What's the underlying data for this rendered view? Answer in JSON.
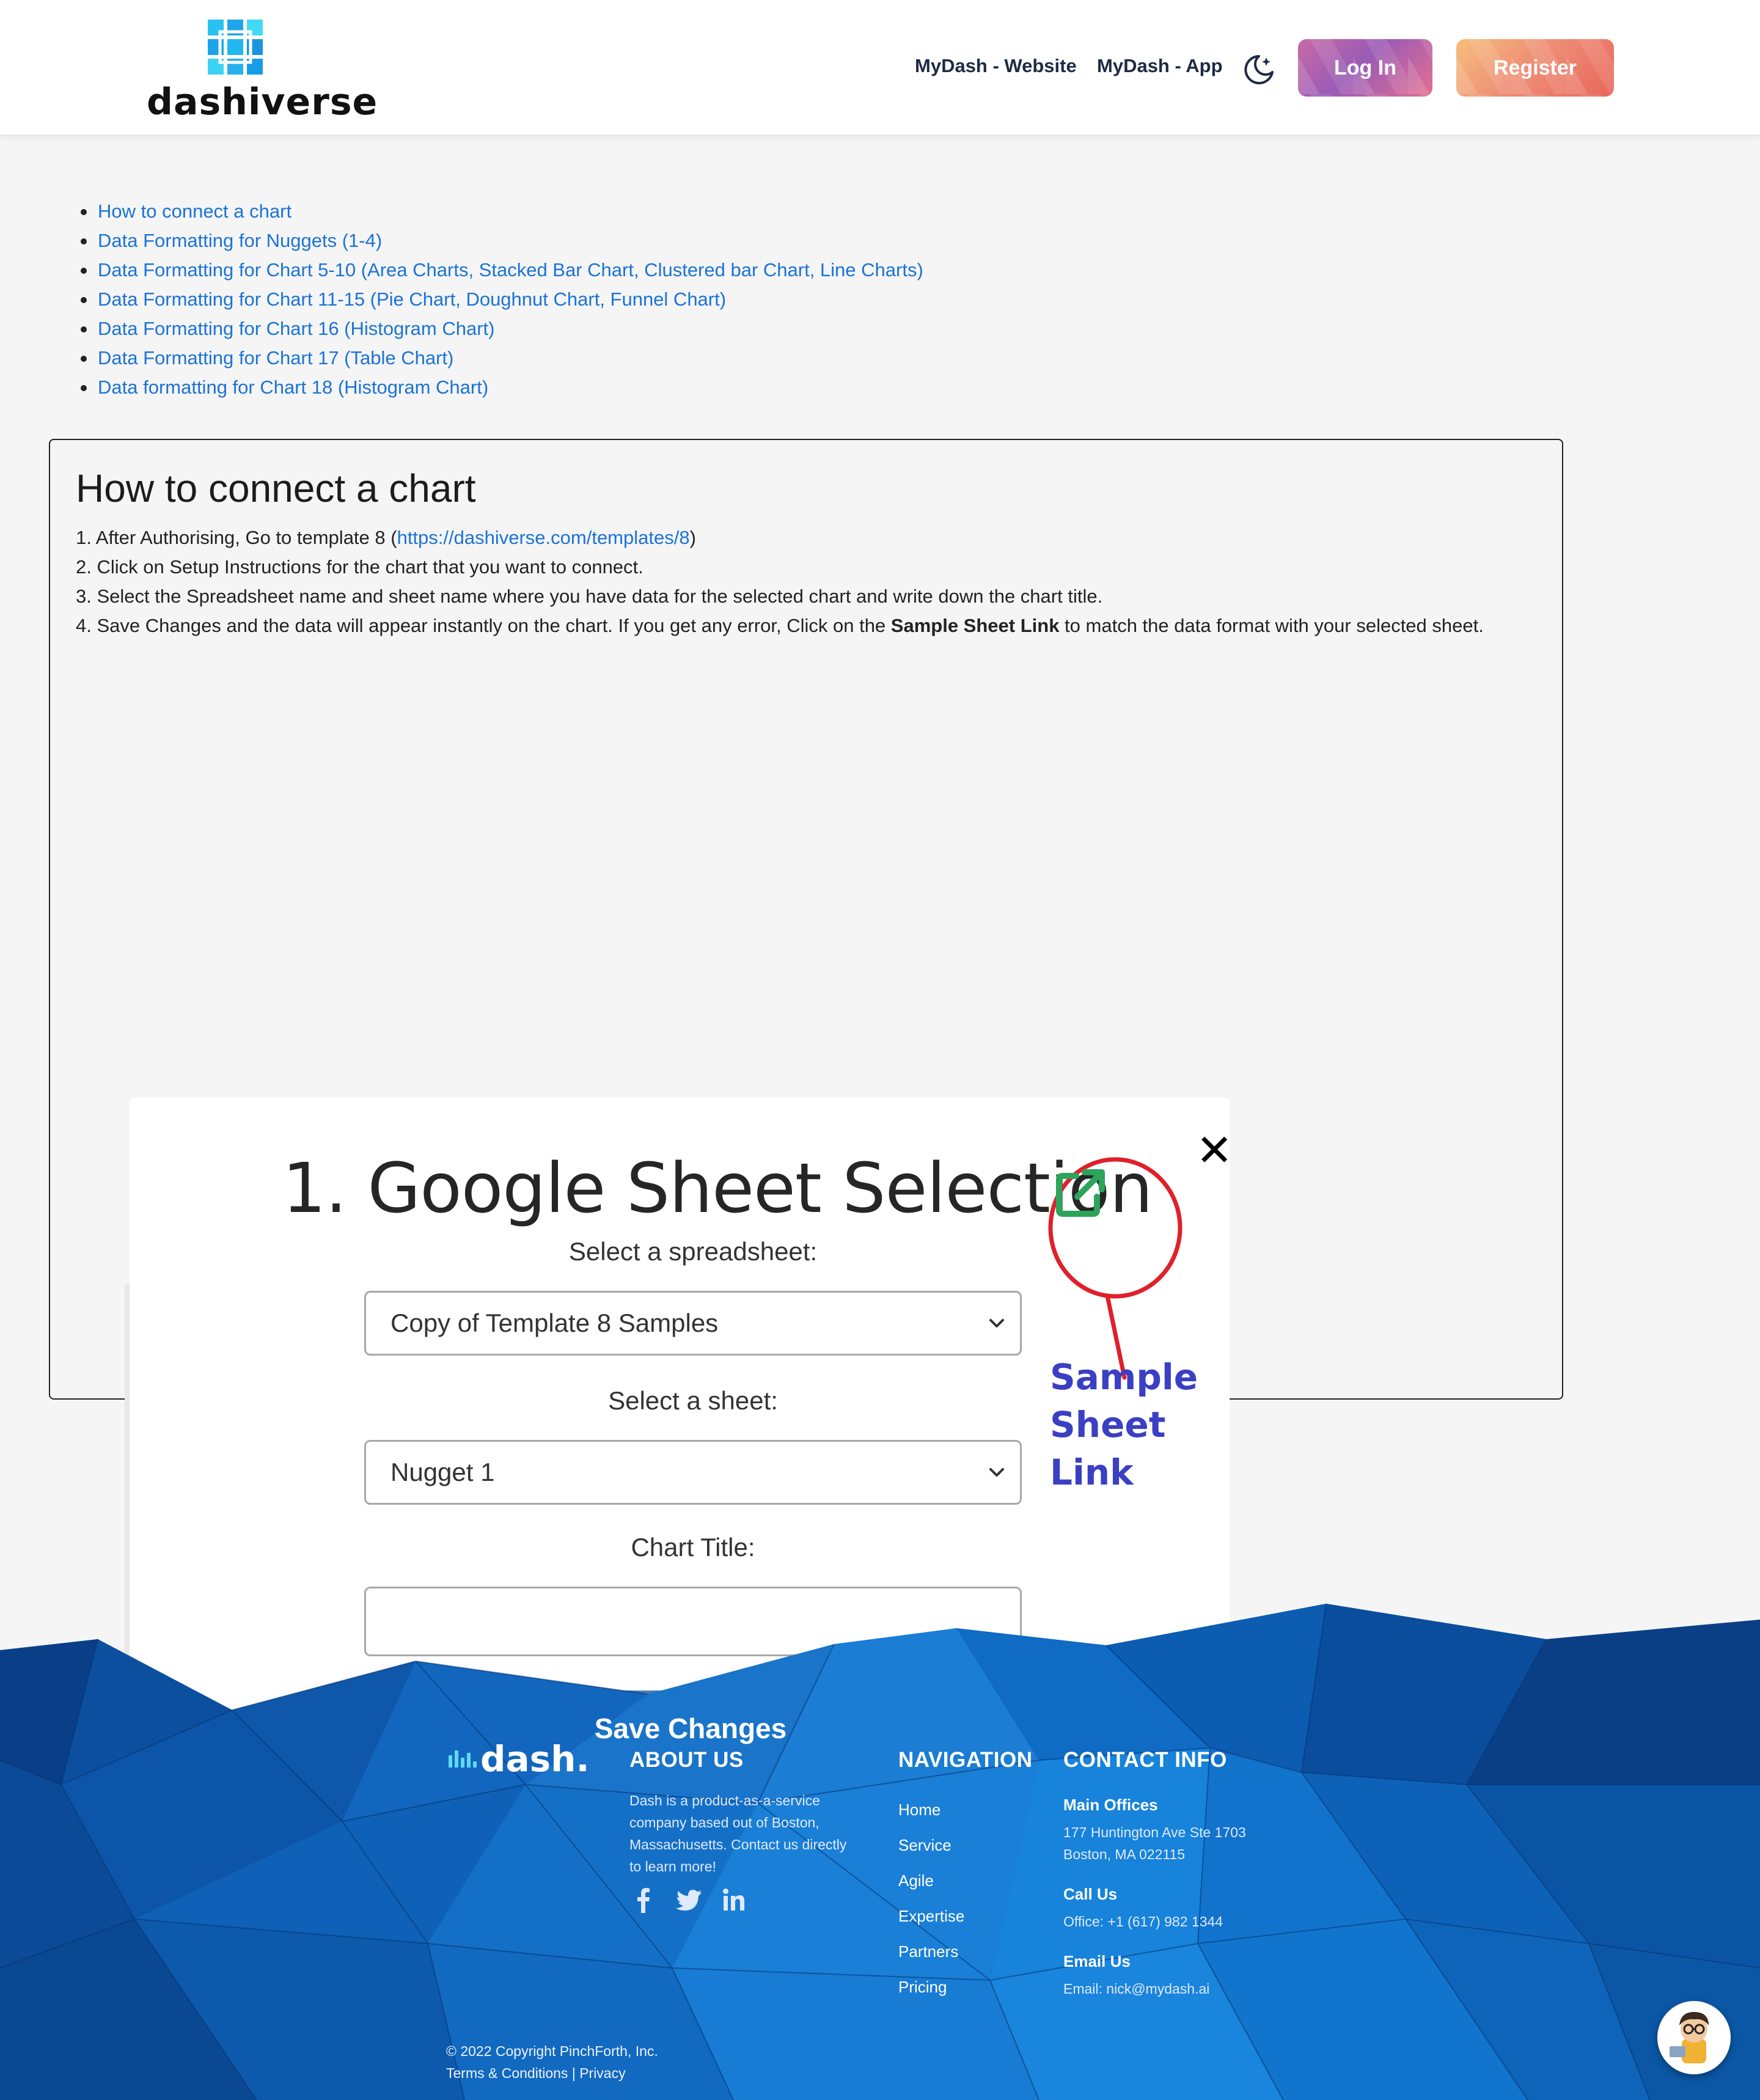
{
  "header": {
    "logo_text": "dashiverse",
    "nav": [
      "MyDash - Website",
      "MyDash - App"
    ],
    "login_label": "Log In",
    "register_label": "Register"
  },
  "toc": [
    "How to connect a chart",
    "Data Formatting for Nuggets (1-4)",
    "Data Formatting for Chart 5-10 (Area Charts, Stacked Bar Chart, Clustered bar Chart, Line Charts)",
    "Data Formatting for Chart 11-15 (Pie Chart, Doughnut Chart, Funnel Chart)",
    "Data Formatting for Chart 16 (Histogram Chart)",
    "Data Formatting for Chart 17 (Table Chart)",
    "Data formatting for Chart 18 (Histogram Chart)"
  ],
  "section": {
    "title": "How to connect a chart",
    "step1_prefix": "After Authorising, Go to template 8 (",
    "step1_link": "https://dashiverse.com/templates/8",
    "step1_suffix": ")",
    "step2": "Click on Setup Instructions for the chart that you want to connect.",
    "step3": "Select the Spreadsheet name and sheet name where you have data for the selected chart and write down the chart title.",
    "step4_prefix": "Save Changes and the data will appear instantly on the chart. If you get any error, Click on the ",
    "step4_bold": "Sample Sheet Link",
    "step4_suffix": " to match the data format with your selected sheet."
  },
  "screenshot": {
    "title": "1. Google Sheet Selection",
    "close": "✕",
    "spreadsheet_label": "Select a spreadsheet:",
    "spreadsheet_value": "Copy of Template 8 Samples",
    "sheet_label": "Select a sheet:",
    "sheet_value": "Nugget 1",
    "chart_title_label": "Chart Title:",
    "chart_title_value": "",
    "save_label": "Save Changes",
    "annotation_line1": "Sample",
    "annotation_line2": "Sheet Link"
  },
  "footer": {
    "logo_text": "dash.",
    "about_heading": "ABOUT US",
    "about_text": [
      "Dash is a product-as-a-service",
      "company based out of Boston,",
      "Massachusetts. Contact us directly",
      "to learn more!"
    ],
    "nav_heading": "NAVIGATION",
    "nav_items": [
      "Home",
      "Service",
      "Agile",
      "Expertise",
      "Partners",
      "Pricing"
    ],
    "contact_heading": "CONTACT INFO",
    "main_offices_label": "Main Offices",
    "address_line1": "177 Huntington Ave Ste 1703",
    "address_line2": "Boston, MA 022115",
    "call_label": "Call Us",
    "phone": "Office: +1 (617) 982 1344",
    "email_label": "Email Us",
    "email": "Email: nick@mydash.ai",
    "copyright": "© 2022 Copyright PinchForth, Inc.",
    "terms": "Terms & Conditions",
    "separator": "|",
    "privacy": "Privacy"
  },
  "icons": [
    "logo-mark-icon",
    "moon-icon",
    "external-link-icon",
    "chevron-down-icon",
    "facebook-icon",
    "twitter-icon",
    "linkedin-icon",
    "avatar-icon"
  ],
  "colors": {
    "link": "#1a73d6",
    "footer_blue": "#0a5fb8",
    "annotation_red": "#e0202a",
    "annotation_text": "#3a3fc4",
    "sheet_link_green": "#2ca55a"
  }
}
